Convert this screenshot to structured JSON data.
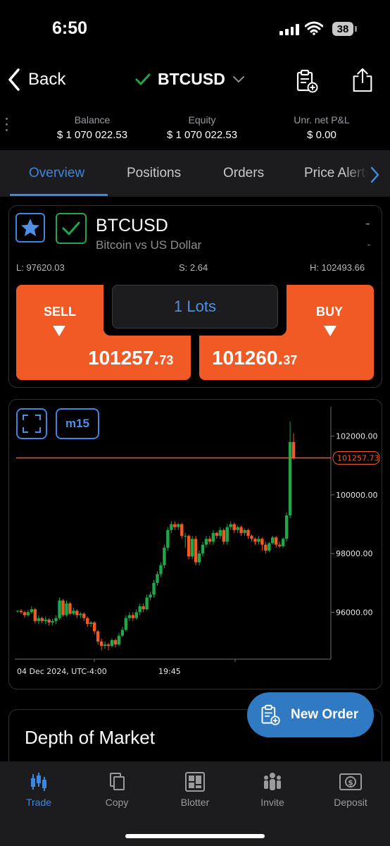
{
  "status_bar": {
    "time": "6:50",
    "battery": "38"
  },
  "nav": {
    "back_label": "Back",
    "symbol": "BTCUSD"
  },
  "account": {
    "balance_label": "Balance",
    "balance_value": "$ 1 070 022.53",
    "equity_label": "Equity",
    "equity_value": "$ 1 070 022.53",
    "pnl_label": "Unr. net P&L",
    "pnl_value": "$ 0.00"
  },
  "tabs": [
    {
      "label": "Overview",
      "active": true
    },
    {
      "label": "Positions"
    },
    {
      "label": "Orders"
    },
    {
      "label": "Price Alerts"
    }
  ],
  "instrument": {
    "name": "BTCUSD",
    "description": "Bitcoin vs US Dollar",
    "change": "-",
    "change_sub": "-",
    "low": "L: 97620.03",
    "spread": "S: 2.64",
    "high": "H: 102493.66",
    "sell_label": "SELL",
    "sell_price_main": "101257.",
    "sell_price_frac": "73",
    "buy_label": "BUY",
    "buy_price_main": "101260.",
    "buy_price_frac": "37",
    "lots": "1 Lots"
  },
  "chart": {
    "timeframe": "m15",
    "date_label": "04 Dec 2024, UTC-4:00",
    "time_label": "19:45",
    "current_price_label": "101257.73",
    "colors": {
      "up": "#1fa74a",
      "down": "#f15a24",
      "line": "#f15a24"
    }
  },
  "chart_data": {
    "type": "candlestick",
    "y_ticks": [
      "102000.00",
      "100000.00",
      "98000.00",
      "96000.00"
    ],
    "ylim": [
      94400,
      103000
    ],
    "current_price": 101257.73,
    "candles": [
      [
        96030,
        96050,
        95980,
        96060
      ],
      [
        96050,
        96000,
        95950,
        96100
      ],
      [
        96000,
        95900,
        95820,
        96050
      ],
      [
        95900,
        96000,
        95850,
        96080
      ],
      [
        96000,
        96100,
        95950,
        96200
      ],
      [
        96100,
        95700,
        95620,
        96150
      ],
      [
        95700,
        95800,
        95600,
        95900
      ],
      [
        95800,
        95700,
        95620,
        95850
      ],
      [
        95700,
        95750,
        95600,
        95850
      ],
      [
        95750,
        95650,
        95550,
        95800
      ],
      [
        95650,
        95700,
        95550,
        95780
      ],
      [
        95700,
        95800,
        95600,
        95900
      ],
      [
        95800,
        96400,
        95750,
        96500
      ],
      [
        96400,
        95900,
        95850,
        96450
      ],
      [
        95900,
        96300,
        95850,
        96400
      ],
      [
        96300,
        95950,
        95900,
        96350
      ],
      [
        95950,
        96050,
        95900,
        96150
      ],
      [
        96050,
        95900,
        95800,
        96100
      ],
      [
        95900,
        95950,
        95800,
        96000
      ],
      [
        95950,
        95800,
        95700,
        96000
      ],
      [
        95800,
        95600,
        95500,
        95850
      ],
      [
        95600,
        95650,
        95500,
        95700
      ],
      [
        95650,
        95350,
        95250,
        95700
      ],
      [
        95350,
        95000,
        94900,
        95400
      ],
      [
        95000,
        94850,
        94700,
        95100
      ],
      [
        94850,
        94900,
        94750,
        95000
      ],
      [
        94900,
        94850,
        94700,
        94950
      ],
      [
        94850,
        95050,
        94800,
        95100
      ],
      [
        95050,
        94900,
        94800,
        95100
      ],
      [
        94900,
        95200,
        94850,
        95300
      ],
      [
        95200,
        95400,
        95150,
        95500
      ],
      [
        95400,
        95800,
        95350,
        95900
      ],
      [
        95800,
        95900,
        95700,
        96000
      ],
      [
        95900,
        95800,
        95700,
        96000
      ],
      [
        95800,
        96000,
        95750,
        96100
      ],
      [
        96000,
        96200,
        95900,
        96300
      ],
      [
        96200,
        96100,
        96000,
        96300
      ],
      [
        96100,
        96500,
        96050,
        96600
      ],
      [
        96500,
        96600,
        96400,
        96700
      ],
      [
        96600,
        97000,
        96500,
        97100
      ],
      [
        97000,
        97300,
        96900,
        97400
      ],
      [
        97300,
        97600,
        97200,
        97700
      ],
      [
        97600,
        98200,
        97500,
        98300
      ],
      [
        98200,
        98800,
        98100,
        98900
      ],
      [
        98800,
        99000,
        98700,
        99100
      ],
      [
        99000,
        98900,
        98800,
        99100
      ],
      [
        98900,
        99000,
        98800,
        99050
      ],
      [
        99000,
        98600,
        98500,
        99050
      ],
      [
        98600,
        98600,
        98200,
        98700
      ],
      [
        98600,
        97900,
        97800,
        98650
      ],
      [
        97900,
        98500,
        97800,
        98600
      ],
      [
        98500,
        97700,
        97600,
        98600
      ],
      [
        97700,
        98000,
        97600,
        98100
      ],
      [
        98000,
        98300,
        97900,
        98400
      ],
      [
        98300,
        98500,
        98200,
        98600
      ],
      [
        98500,
        98400,
        98300,
        98600
      ],
      [
        98400,
        98700,
        98300,
        98800
      ],
      [
        98700,
        98600,
        98500,
        98750
      ],
      [
        98600,
        98800,
        98500,
        98900
      ],
      [
        98800,
        98400,
        98300,
        98850
      ],
      [
        98400,
        98900,
        98300,
        99000
      ],
      [
        98900,
        99000,
        98800,
        99100
      ],
      [
        99000,
        98800,
        98700,
        99050
      ],
      [
        98800,
        98900,
        98700,
        98950
      ],
      [
        98900,
        98700,
        98600,
        98950
      ],
      [
        98700,
        98800,
        98600,
        98850
      ],
      [
        98800,
        98600,
        98500,
        98850
      ],
      [
        98600,
        98500,
        98400,
        98650
      ],
      [
        98500,
        98400,
        98300,
        98550
      ],
      [
        98400,
        98500,
        98300,
        98600
      ],
      [
        98500,
        98300,
        98100,
        98550
      ],
      [
        98300,
        98100,
        98000,
        98400
      ],
      [
        98100,
        98350,
        98050,
        98400
      ],
      [
        98350,
        98550,
        98300,
        98600
      ],
      [
        98550,
        98300,
        98200,
        98600
      ],
      [
        98300,
        98250,
        98200,
        98400
      ],
      [
        98250,
        98500,
        98200,
        98550
      ],
      [
        98500,
        99300,
        98400,
        99400
      ],
      [
        99300,
        101800,
        99200,
        102500
      ],
      [
        101800,
        101250,
        101200,
        102100
      ]
    ]
  }
}
